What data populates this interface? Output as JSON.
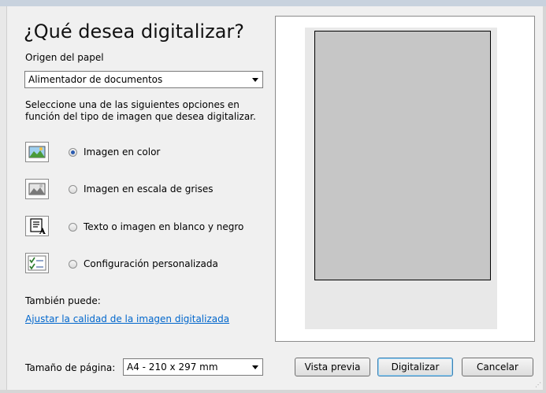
{
  "dialog": {
    "title": "¿Qué desea digitalizar?"
  },
  "paper_source": {
    "label": "Origen del papel",
    "value": "Alimentador de documentos"
  },
  "instructions": "Seleccione una de las siguientes opciones en función del tipo de imagen que desea digitalizar.",
  "options": [
    {
      "label": "Imagen en color",
      "checked": true,
      "icon": "color-photo-icon"
    },
    {
      "label": "Imagen en escala de grises",
      "checked": false,
      "icon": "grayscale-photo-icon"
    },
    {
      "label": "Texto o imagen en blanco y negro",
      "checked": false,
      "icon": "text-bw-icon"
    },
    {
      "label": "Configuración personalizada",
      "checked": false,
      "icon": "custom-settings-icon"
    }
  ],
  "also": {
    "label": "También puede:",
    "link": "Ajustar la calidad de la imagen digitalizada"
  },
  "page_size": {
    "label": "Tamaño de página:",
    "value": "A4 - 210 x 297 mm"
  },
  "buttons": {
    "preview": "Vista previa",
    "scan": "Digitalizar",
    "cancel": "Cancelar"
  },
  "colors": {
    "link": "#0066cc",
    "scan_area": "#c6c6c6",
    "radio_selected": "#2a5bb0"
  }
}
